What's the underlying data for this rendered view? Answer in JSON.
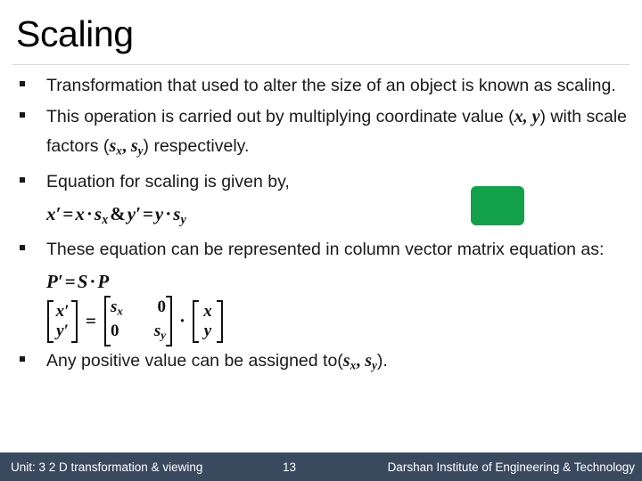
{
  "slide": {
    "title": "Scaling",
    "bullets": [
      {
        "id": "bullet-definition",
        "text": "Transformation that used to alter the size of an object is known as scaling."
      },
      {
        "id": "bullet-operation",
        "text_part1": "This operation is carried out by multiplying coordinate value (",
        "math_xy": "x, y",
        "text_part2": ") with scale factors (",
        "math_s": "s",
        "sub_x": "x",
        "comma": ", ",
        "math_s2": "s",
        "sub_y": "y",
        "text_part3": ") respectively."
      },
      {
        "id": "bullet-equation",
        "text": "Equation for scaling is given by,"
      },
      {
        "id": "bullet-matrix",
        "text": "These equation can be represented in column vector matrix equation as:"
      },
      {
        "id": "bullet-positive",
        "text_part1": "Any positive value can be assigned to(",
        "math_s": "s",
        "sub_x": "x",
        "comma": ", ",
        "math_s2": "s",
        "sub_y": "y",
        "text_part2": ")."
      }
    ],
    "equations": {
      "scaling_scalar": {
        "lhs_x": "x",
        "prime": "′",
        "eq": "=",
        "x": "x",
        "dot": "·",
        "s": "s",
        "sub_x": "x",
        "amp": "&",
        "lhs_y": "y",
        "y": "y",
        "s2": "s",
        "sub_y": "y",
        "full": "x′ = x · sₓ & y′ = y · sᵧ"
      },
      "matrix_shorthand": {
        "p_prime": "P",
        "prime": "′",
        "eq": "=",
        "s": "S",
        "dot": "·",
        "p": "P",
        "full": "P′ = S · P"
      },
      "matrix_full": {
        "lhs": {
          "row1": "x′",
          "row2": "y′"
        },
        "eq": "=",
        "scale_matrix": {
          "r1c1_s": "s",
          "r1c1_sub": "x",
          "r1c2": "0",
          "r2c1": "0",
          "r2c2_s": "s",
          "r2c2_sub": "y"
        },
        "dot": "·",
        "rhs": {
          "row1": "x",
          "row2": "y"
        }
      }
    },
    "shapes": {
      "green_box": {
        "name": "green-rounded-rectangle",
        "color": "#12a04a"
      }
    },
    "footer": {
      "unit": "Unit: 3 2 D transformation & viewing",
      "page": "13",
      "organization": "Darshan Institute of Engineering & Technology",
      "background": "#3a4a5e",
      "text_color": "#ffffff"
    }
  }
}
